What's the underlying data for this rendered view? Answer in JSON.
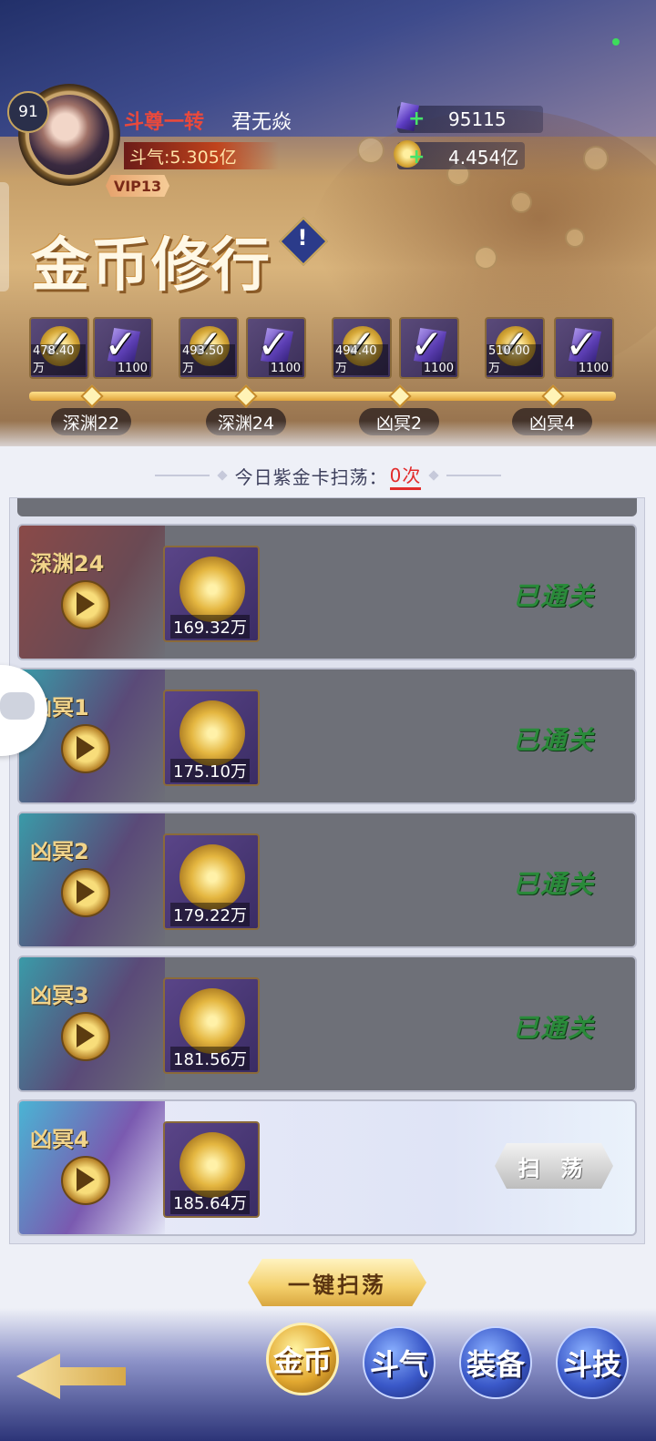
{
  "player": {
    "level": "91",
    "rank_title": "斗尊一转",
    "name": "君无焱",
    "power": "斗气:5.305亿",
    "vip": "VIP13"
  },
  "resources": {
    "gem": "95115",
    "gold": "4.454亿"
  },
  "page_title": "金币修行",
  "info_mark": "!",
  "milestones": [
    {
      "label": "深渊22",
      "gold": "478.40万",
      "gem": "1100"
    },
    {
      "label": "深渊24",
      "gold": "493.50万",
      "gem": "1100"
    },
    {
      "label": "凶冥2",
      "gold": "494.40万",
      "gem": "1100"
    },
    {
      "label": "凶冥4",
      "gold": "510.00万",
      "gem": "1100"
    }
  ],
  "daily_sweep": {
    "label": "今日紫金卡扫荡：",
    "count": "0次"
  },
  "stages": [
    {
      "name": "深渊24",
      "reward": "169.32万",
      "status": "已通关"
    },
    {
      "name": "凶冥1",
      "reward": "175.10万",
      "status": "已通关"
    },
    {
      "name": "凶冥2",
      "reward": "179.22万",
      "status": "已通关"
    },
    {
      "name": "凶冥3",
      "reward": "181.56万",
      "status": "已通关"
    },
    {
      "name": "凶冥4",
      "reward": "185.64万",
      "sweep_label": "扫 荡"
    }
  ],
  "one_key_sweep": "一键扫荡",
  "tabs": {
    "gold": "金币",
    "qi": "斗气",
    "equip": "装备",
    "skill": "斗技"
  },
  "colors": {
    "accent_red": "#e22b2b",
    "passed_green": "#2a8a3a",
    "gold": "#e4b640"
  }
}
